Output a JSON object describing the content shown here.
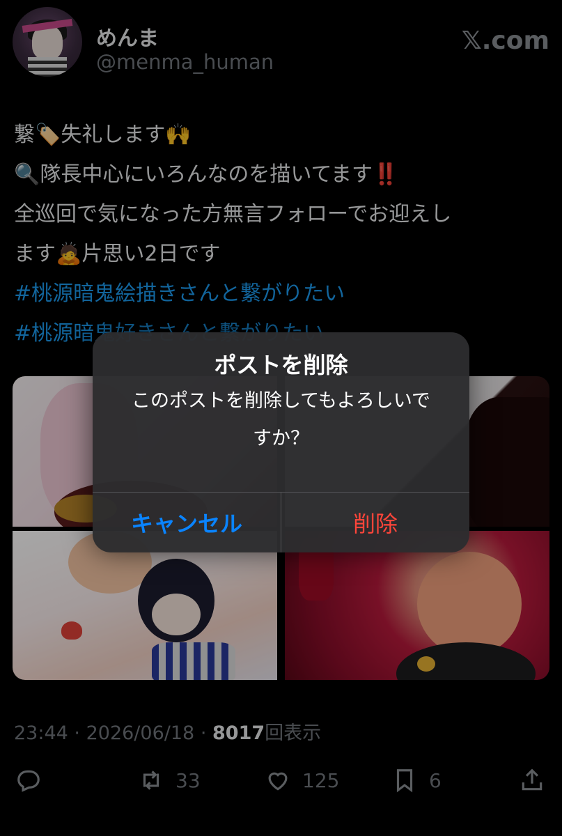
{
  "header": {
    "name": "めんま",
    "handle": "@menma_human",
    "site": "𝕏.com"
  },
  "tweet": {
    "line1": "繋🏷️失礼します🙌",
    "line2": "🔍隊長中心にいろんなのを描いてます‼️",
    "line3": "全巡回で気になった方無言フォローでお迎えし",
    "line4": "ます🙇片思い2日です",
    "hashtags": [
      "#桃源暗鬼絵描きさんと繋がりたい",
      "#桃源暗鬼好きさんと繋がりたい"
    ]
  },
  "meta": {
    "time": "23:44",
    "sep": "·",
    "date": "2026/06/18",
    "views_count": "8017",
    "views_label": "回表示"
  },
  "actions": {
    "reposts": "33",
    "likes": "125",
    "bookmarks": "6"
  },
  "icons": [
    "reply-icon",
    "repost-icon",
    "like-icon",
    "bookmark-icon",
    "share-icon"
  ],
  "colors": {
    "background": "#000000",
    "hashtag": "#1d9bf0",
    "muted": "#71767b",
    "cancel": "#0a84ff",
    "destructive": "#ff453a"
  },
  "alert": {
    "title": "ポストを削除",
    "message": "このポストを削除してもよろしいですか？",
    "cancel_label": "キャンセル",
    "delete_label": "削除"
  }
}
